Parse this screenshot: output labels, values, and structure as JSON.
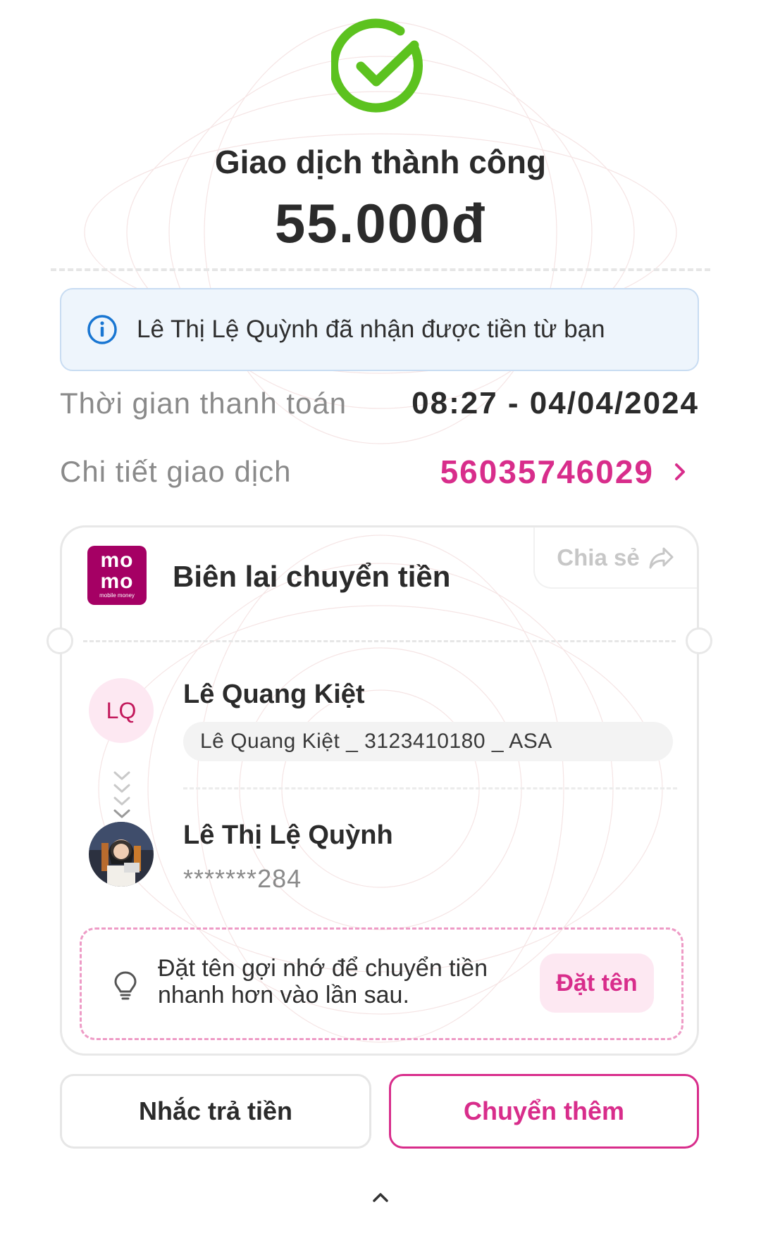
{
  "status": {
    "title": "Giao dịch thành công",
    "amount": "55.000đ"
  },
  "info_banner": {
    "icon": "info-icon",
    "text": "Lê Thị Lệ Quỳnh đã nhận được tiền từ bạn"
  },
  "details": {
    "time_label": "Thời gian thanh toán",
    "time_value": "08:27 - 04/04/2024",
    "transaction_label": "Chi tiết giao dịch",
    "transaction_id": "56035746029"
  },
  "receipt": {
    "logo": {
      "line1": "mo",
      "line2": "mo",
      "tagline": "mobile money"
    },
    "title": "Biên lai chuyển tiền",
    "share_label": "Chia sẻ",
    "sender": {
      "initials": "LQ",
      "name": "Lê Quang Kiệt",
      "note": "Lê Quang Kiệt _ 3123410180 _ ASA"
    },
    "receiver": {
      "name": "Lê Thị Lệ Quỳnh",
      "account": "*******284"
    },
    "tip": {
      "text": "Đặt tên gợi nhớ để chuyển tiền nhanh hơn vào lần sau.",
      "button": "Đặt tên"
    }
  },
  "actions": {
    "remind": "Nhắc trả tiền",
    "transfer_more": "Chuyển thêm"
  },
  "colors": {
    "accent": "#d82d8b",
    "brand": "#a50064",
    "success": "#5cc21f",
    "info": "#1976d2"
  }
}
